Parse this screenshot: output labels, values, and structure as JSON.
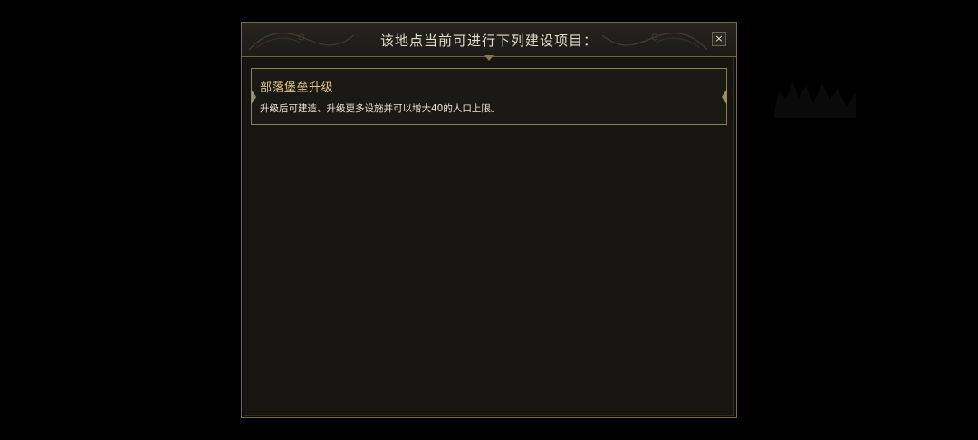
{
  "dialog": {
    "title": "该地点当前可进行下列建设项目：",
    "close_label": "×"
  },
  "projects": [
    {
      "name": "部落堡垒升级",
      "description": "升级后可建造、升级更多设施并可以增大40的人口上限。"
    }
  ],
  "colors": {
    "background": "#000000",
    "panel": "#161510",
    "border_gold": "#7a6a45",
    "title_text": "#e2dccb",
    "project_name": "#e3c98c",
    "project_desc": "#e8e4d8"
  },
  "icons": {
    "close": "close-icon",
    "header_ornament": "filigree-ornament-icon"
  }
}
